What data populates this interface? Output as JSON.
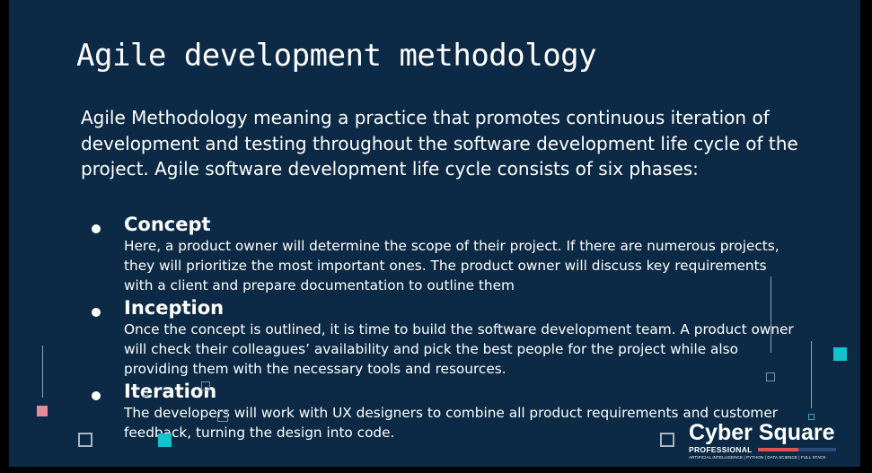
{
  "slide": {
    "title": "Agile development methodology",
    "intro": "Agile Methodology meaning a practice that promotes continuous iteration of development and testing throughout the software development life cycle of the project. Agile software development life cycle consists of six phases:",
    "phases": [
      {
        "name": "Concept",
        "description": "Here, a product owner will determine the scope of their project. If there are numerous projects, they will prioritize the most important ones. The product owner will discuss key requirements with a client and prepare documentation to outline them"
      },
      {
        "name": "Inception",
        "description": "Once the concept is outlined, it is time to build the software development team. A product owner will check their colleagues’ availability and pick the best people for the project while also providing them with the necessary tools and resources."
      },
      {
        "name": "Iteration",
        "description": "The developers will work with UX designers to combine all product requirements and customer feedback, turning the design into code."
      }
    ]
  },
  "logo": {
    "brand": "Cyber Square",
    "sub": "PROFESSIONAL",
    "tagline": "ARTIFICIAL INTELLIGENCE | PYTHON | DATA SCIENCE | FULL STACK"
  },
  "colors": {
    "background": "#0c2a45",
    "accent_cyan": "#12c2cf",
    "accent_pink": "#e88a9a",
    "logo_red": "#d9534f"
  }
}
